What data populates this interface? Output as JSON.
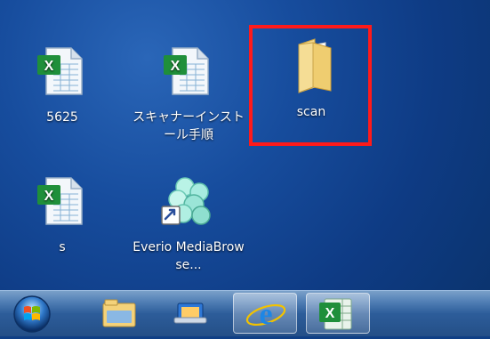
{
  "desktop": {
    "icons": [
      {
        "label": "5625",
        "icon": "excel-file-icon"
      },
      {
        "label": "スキャナーインストール手順",
        "icon": "excel-file-icon"
      },
      {
        "label": "scan",
        "icon": "folder-icon",
        "highlighted": true
      },
      {
        "label": "s",
        "icon": "excel-file-icon"
      },
      {
        "label": "Everio MediaBrowse...",
        "icon": "everio-shortcut-icon"
      }
    ]
  },
  "taskbar": {
    "items": [
      {
        "name": "start-button",
        "icon": "windows-logo-icon"
      },
      {
        "name": "file-explorer",
        "icon": "file-explorer-icon"
      },
      {
        "name": "media-center",
        "icon": "media-center-icon"
      },
      {
        "name": "internet-explorer",
        "icon": "internet-explorer-icon",
        "active": true
      },
      {
        "name": "excel",
        "icon": "excel-icon",
        "active": true
      }
    ]
  },
  "colors": {
    "desktop_bg": "#164d9e",
    "selection_red": "#ff1a1a",
    "taskbar_bg": "#2d5d9a"
  }
}
